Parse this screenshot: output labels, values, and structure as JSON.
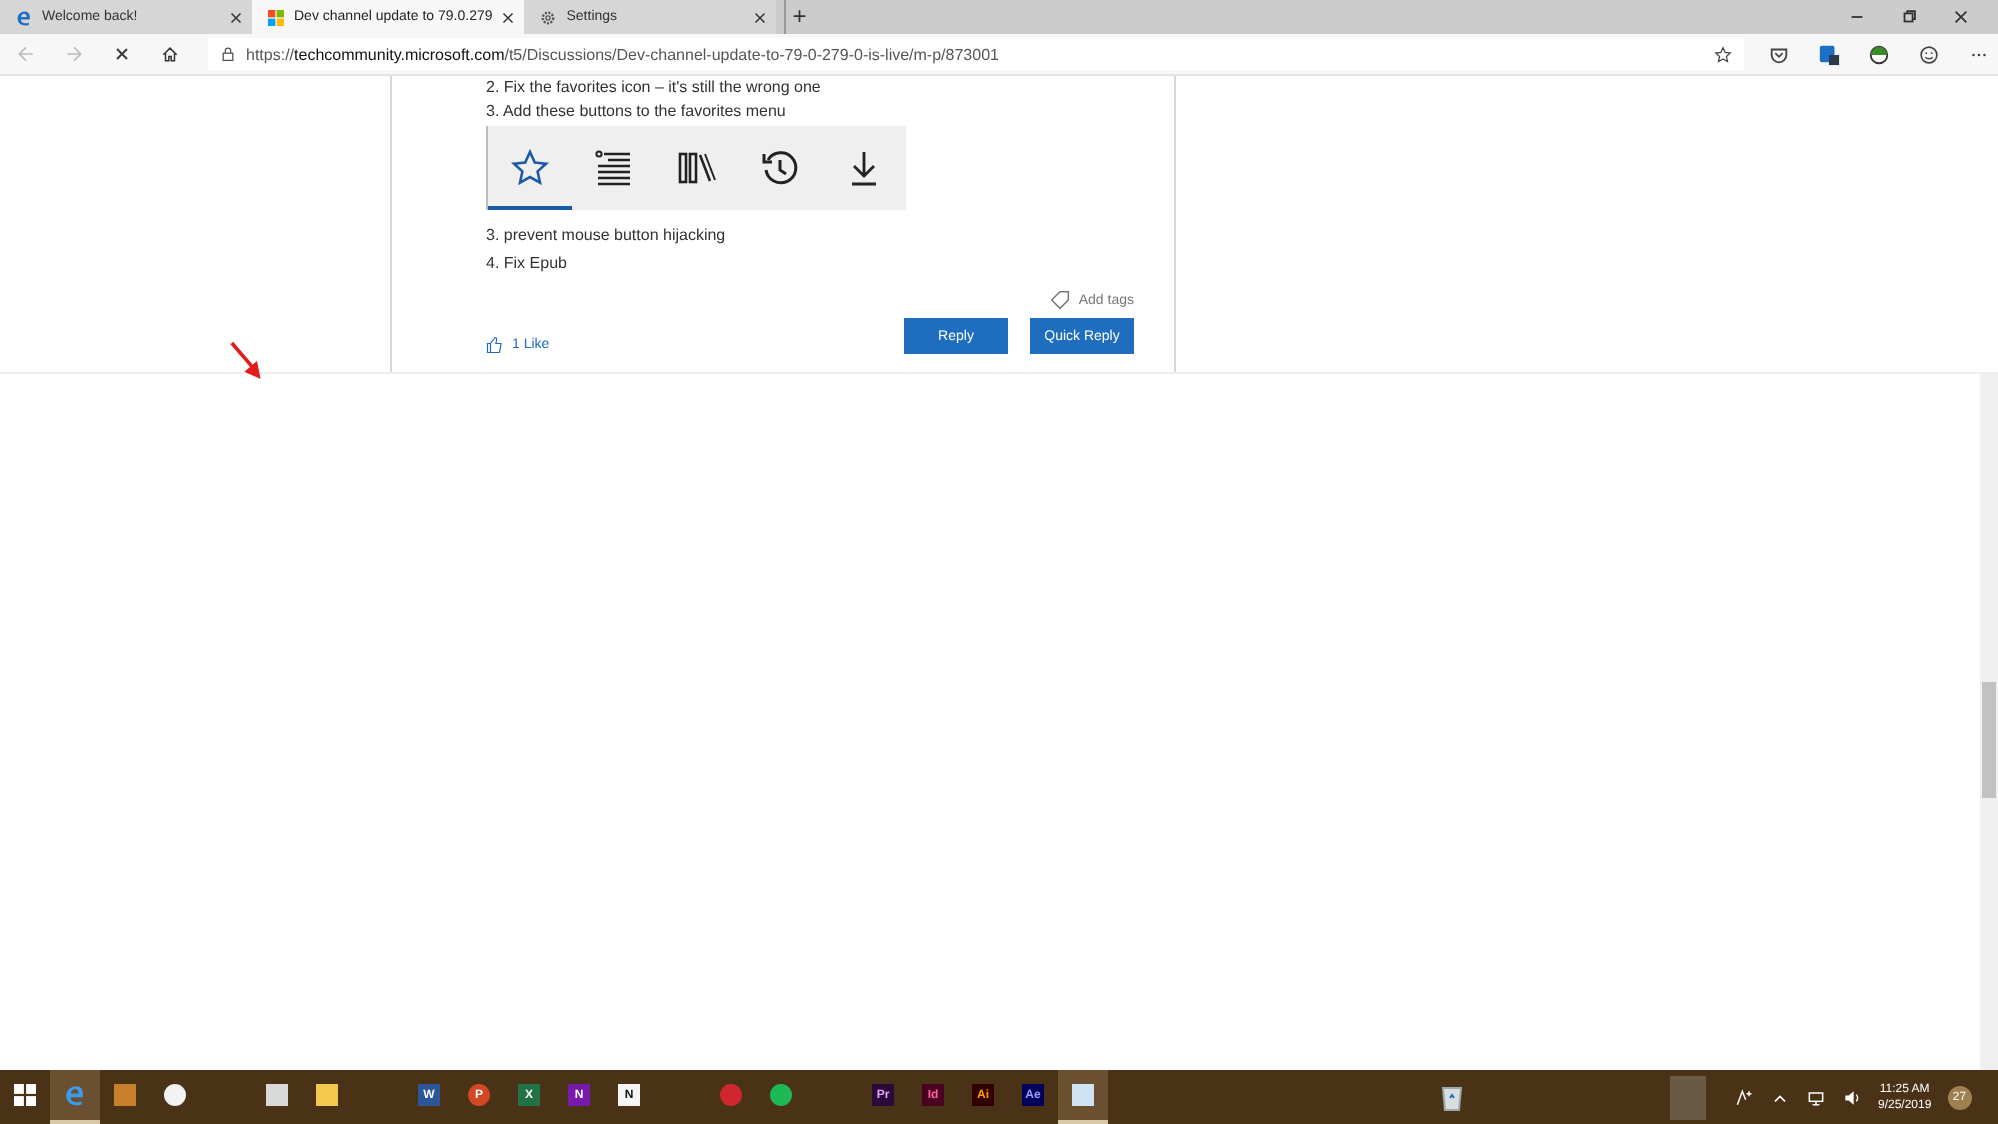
{
  "browser": {
    "tabs": [
      {
        "title": "Welcome back!",
        "kind": "edge",
        "selected": false
      },
      {
        "title": "Dev channel update to 79.0.279",
        "kind": "windows",
        "selected": true
      },
      {
        "title": "Settings",
        "kind": "gear",
        "selected": false
      }
    ],
    "new_tab": "+",
    "address": {
      "scheme": "https://",
      "host": "techcommunity.microsoft.com",
      "path": "/t5/Discussions/Dev-channel-update-to-79-0-279-0-is-live/m-p/873001"
    }
  },
  "post": {
    "lines_before": [
      "2. Fix the favorites icon – it's still the wrong one",
      "3. Add these buttons to the favorites menu"
    ],
    "toolbar_image": [
      {
        "kind": "star",
        "selected": true
      },
      {
        "kind": "list",
        "selected": false
      },
      {
        "kind": "library",
        "selected": false
      },
      {
        "kind": "history",
        "selected": false
      },
      {
        "kind": "download",
        "selected": false
      }
    ],
    "lines_after": [
      "3. prevent mouse button hijacking",
      "4. Fix Epub"
    ],
    "add_tags": "Add tags",
    "like": "1 Like",
    "buttons": [
      "Reply",
      "Quick Reply"
    ]
  },
  "taskbar": {
    "groups": [
      [
        {
          "kind": "start",
          "selected": false
        },
        {
          "kind": "edge",
          "selected": true
        },
        {
          "kind": "tile",
          "color": "#c8812a",
          "selected": false
        },
        {
          "kind": "round",
          "color": "#f2f2f2",
          "selected": false
        }
      ],
      [
        {
          "kind": "tile",
          "color": "#d9d9d9",
          "selected": false
        },
        {
          "kind": "tile",
          "color": "#f2c94c",
          "selected": false
        }
      ],
      [
        {
          "kind": "tile",
          "color": "#2b579a",
          "label": "W",
          "selected": false
        },
        {
          "kind": "round",
          "color": "#d24726",
          "label": "P",
          "selected": false
        },
        {
          "kind": "tile",
          "color": "#217346",
          "label": "X",
          "selected": false
        },
        {
          "kind": "tile",
          "color": "#7719aa",
          "label": "N",
          "selected": false
        },
        {
          "kind": "tile",
          "color": "#f5f5f5",
          "label": "N",
          "selected": false
        }
      ],
      [
        {
          "kind": "round",
          "color": "#d0262f",
          "selected": false
        },
        {
          "kind": "round",
          "color": "#1db954",
          "selected": false
        }
      ],
      [
        {
          "kind": "tile",
          "color": "#2a0a3a",
          "label": "Pr",
          "selected": false
        },
        {
          "kind": "tile",
          "color": "#49021f",
          "label": "Id",
          "selected": false
        },
        {
          "kind": "tile",
          "color": "#330000",
          "label": "Ai",
          "selected": false
        },
        {
          "kind": "tile",
          "color": "#00005b",
          "label": "Ae",
          "selected": false
        },
        {
          "kind": "tile",
          "color": "#cfe3f3",
          "selected": true
        }
      ]
    ],
    "time": "11:25 AM",
    "date": "9/25/2019",
    "notifications": "27"
  }
}
